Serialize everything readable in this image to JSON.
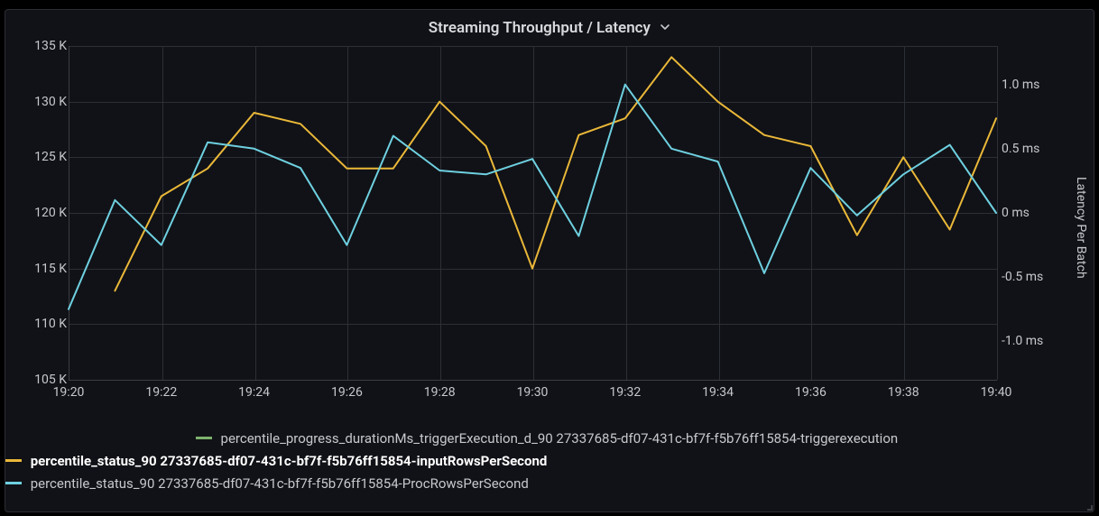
{
  "panel": {
    "title": "Streaming Throughput / Latency"
  },
  "chart_data": {
    "type": "line",
    "title": "Streaming Throughput / Latency",
    "x_ticks": [
      "19:20",
      "19:22",
      "19:24",
      "19:26",
      "19:28",
      "19:30",
      "19:32",
      "19:34",
      "19:36",
      "19:38",
      "19:40"
    ],
    "y_left": {
      "label": "",
      "unit": "K",
      "ticks": [
        105,
        110,
        115,
        120,
        125,
        130,
        135
      ],
      "range": [
        105,
        135
      ]
    },
    "y_right": {
      "label": "Latency Per Batch",
      "unit": "ms",
      "ticks": [
        -1.0,
        -0.5,
        0.0,
        0.5,
        1.0
      ],
      "range": [
        -1.3,
        1.3
      ]
    },
    "series": [
      {
        "name": "percentile_progress_durationMs_triggerExecution_d_90 27337685-df07-431c-bf7f-f5b76ff15854-triggerexecution",
        "color": "#7EB26D",
        "axis": "right",
        "x": [],
        "y": []
      },
      {
        "name": "percentile_status_90 27337685-df07-431c-bf7f-f5b76ff15854-inputRowsPerSecond",
        "color": "#EAB839",
        "axis": "left",
        "bold": true,
        "x": [
          "19:21",
          "19:22",
          "19:23",
          "19:24",
          "19:25",
          "19:26",
          "19:27",
          "19:28",
          "19:29",
          "19:30",
          "19:31",
          "19:32",
          "19:33",
          "19:34",
          "19:35",
          "19:36",
          "19:37",
          "19:38",
          "19:39",
          "19:40"
        ],
        "y": [
          113.0,
          121.5,
          124.0,
          129.0,
          128.0,
          124.0,
          124.0,
          130.0,
          126.0,
          115.0,
          127.0,
          128.5,
          134.0,
          130.0,
          127.0,
          126.0,
          118.0,
          125.0,
          118.5,
          128.5
        ]
      },
      {
        "name": "percentile_status_90 27337685-df07-431c-bf7f-f5b76ff15854-ProcRowsPerSecond",
        "color": "#6ED0E0",
        "axis": "right",
        "x": [
          "19:20",
          "19:21",
          "19:22",
          "19:23",
          "19:24",
          "19:25",
          "19:26",
          "19:27",
          "19:28",
          "19:29",
          "19:30",
          "19:31",
          "19:32",
          "19:33",
          "19:34",
          "19:35",
          "19:36",
          "19:37",
          "19:38",
          "19:39",
          "19:40"
        ],
        "y": [
          -0.75,
          0.1,
          -0.25,
          0.55,
          0.5,
          0.35,
          -0.25,
          0.6,
          0.33,
          0.3,
          0.42,
          -0.18,
          1.0,
          0.5,
          0.4,
          -0.47,
          0.35,
          -0.02,
          0.3,
          0.53,
          0.0
        ]
      }
    ]
  }
}
